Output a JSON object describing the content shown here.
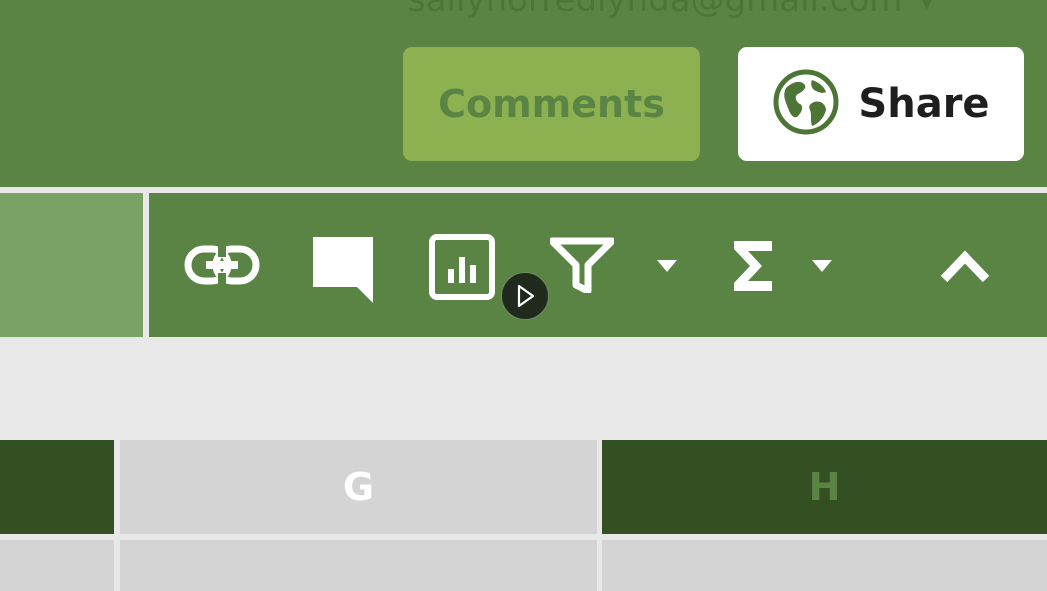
{
  "header": {
    "account_email": "sallyhorredlynda@gmail.com",
    "account_caret_icon": "caret-down-icon",
    "comments_label": "Comments",
    "share_label": "Share",
    "share_icon": "globe-icon"
  },
  "ribbon": {
    "tools": [
      {
        "name": "link",
        "icon": "link-icon"
      },
      {
        "name": "comment",
        "icon": "comment-icon"
      },
      {
        "name": "chart",
        "icon": "bar-chart-icon"
      },
      {
        "name": "filter",
        "icon": "filter-icon",
        "has_dropdown": true
      },
      {
        "name": "autosum",
        "icon": "sigma-icon",
        "has_dropdown": true
      },
      {
        "name": "collapse",
        "icon": "chevron-up-icon"
      }
    ]
  },
  "grid": {
    "columns": [
      {
        "label": "",
        "selected": true
      },
      {
        "label": "G",
        "selected": false
      },
      {
        "label": "H",
        "selected": true
      }
    ]
  },
  "colors": {
    "brand_green": "#5a8443",
    "comments_button": "#8db050",
    "selected_header": "#344f22",
    "header_text_selected": "#5a8443",
    "header_text_normal": "#ffffff",
    "light_gray": "#d4d4d4"
  }
}
